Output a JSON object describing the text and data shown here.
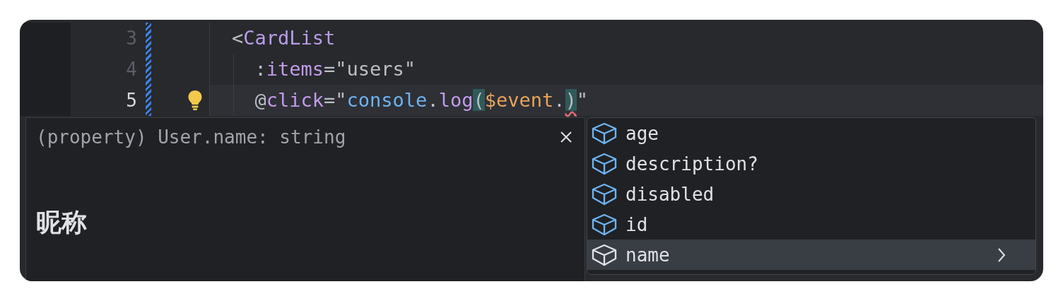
{
  "editor": {
    "lines": [
      {
        "number": "3",
        "current": false,
        "bulb": false,
        "tokens": [
          {
            "text": "<",
            "kind": "plain"
          },
          {
            "text": "CardList",
            "kind": "tag"
          }
        ]
      },
      {
        "number": "4",
        "current": false,
        "bulb": false,
        "tokens": [
          {
            "text": "  :",
            "kind": "plain"
          },
          {
            "text": "items",
            "kind": "attr"
          },
          {
            "text": "=\"users\"",
            "kind": "plain"
          }
        ]
      },
      {
        "number": "5",
        "current": true,
        "bulb": true,
        "tokens": [
          {
            "text": "  @",
            "kind": "plain"
          },
          {
            "text": "click",
            "kind": "attr"
          },
          {
            "text": "=\"",
            "kind": "plain"
          },
          {
            "text": "console",
            "kind": "object"
          },
          {
            "text": ".",
            "kind": "plain"
          },
          {
            "text": "log",
            "kind": "attr"
          },
          {
            "text": "(",
            "kind": "plain",
            "matched": true
          },
          {
            "text": "$event",
            "kind": "variable"
          },
          {
            "text": ".",
            "kind": "plain"
          },
          {
            "text": ")",
            "kind": "plain",
            "matched": true,
            "error": true
          },
          {
            "text": "\"",
            "kind": "plain"
          }
        ]
      }
    ]
  },
  "doc_popup": {
    "signature": "(property) User.name: string",
    "description": "昵称"
  },
  "completion": {
    "items": [
      {
        "label": "age",
        "selected": false,
        "submenu": false
      },
      {
        "label": "description?",
        "selected": false,
        "submenu": false
      },
      {
        "label": "disabled",
        "selected": false,
        "submenu": false
      },
      {
        "label": "id",
        "selected": false,
        "submenu": false
      },
      {
        "label": "name",
        "selected": true,
        "submenu": true
      }
    ]
  }
}
